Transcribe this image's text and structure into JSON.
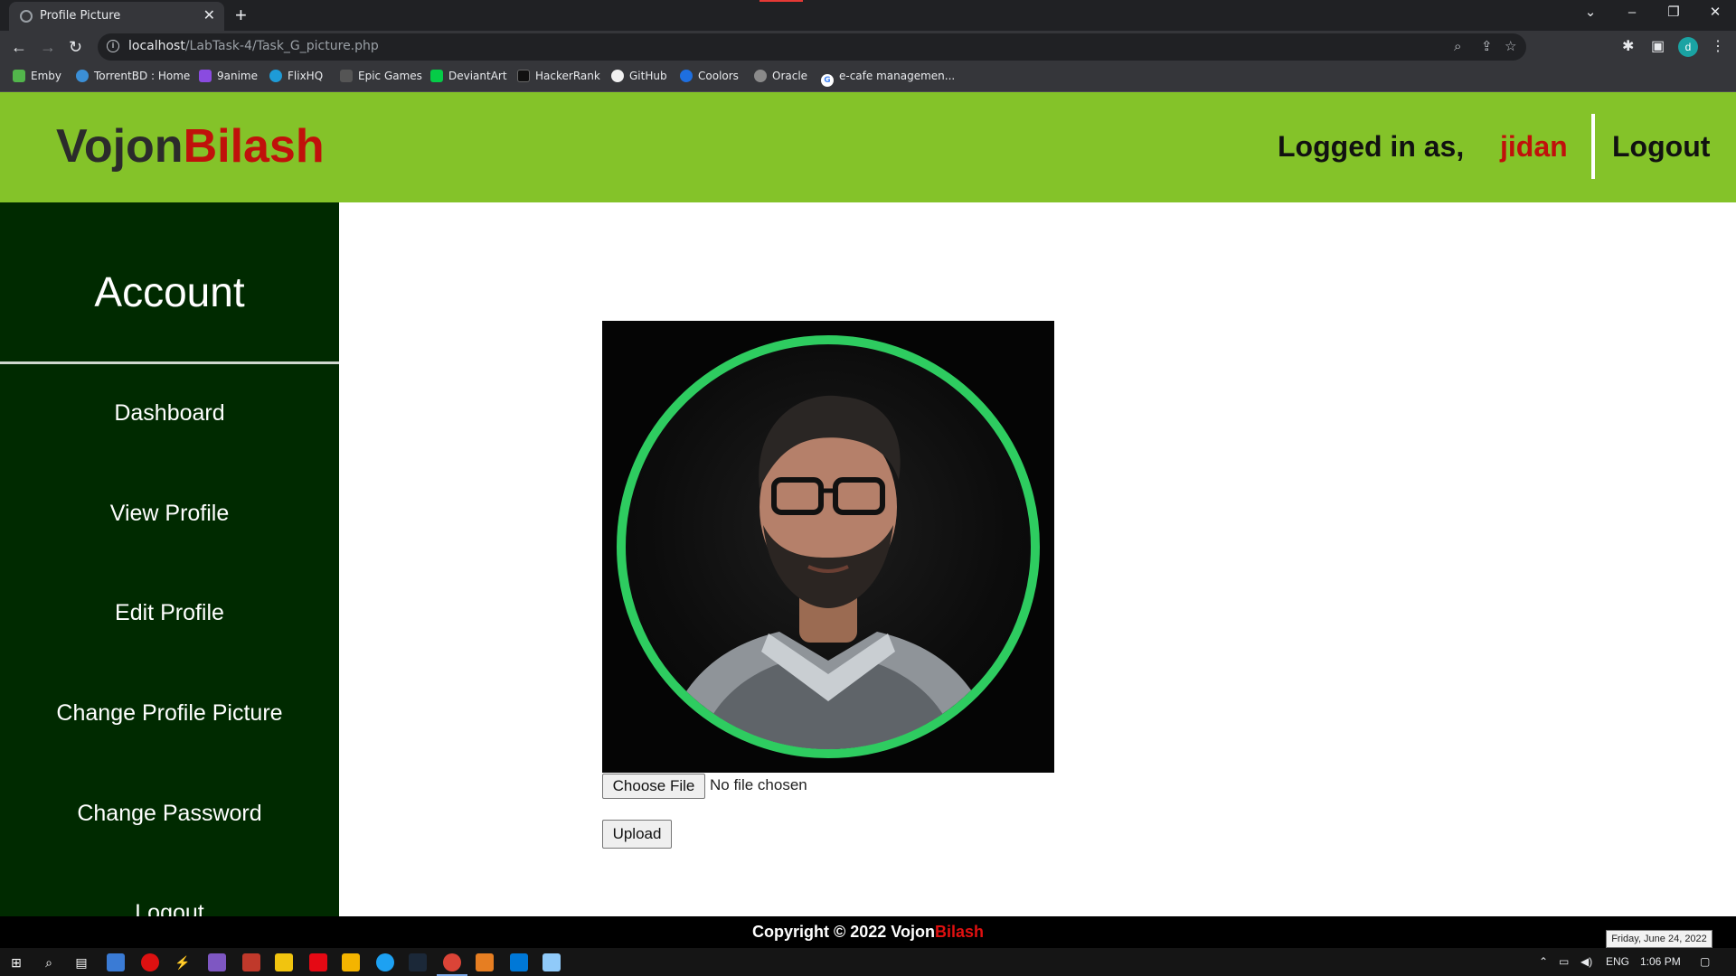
{
  "browser": {
    "tab_title": "Profile Picture",
    "url_host": "localhost",
    "url_path": "/LabTask-4/Task_G_picture.php",
    "profile_initial": "d",
    "bookmarks": [
      {
        "label": "Emby",
        "color": "#52b54b"
      },
      {
        "label": "TorrentBD : Home",
        "color": "#3b8fd6"
      },
      {
        "label": "9anime",
        "color": "#8a4be0"
      },
      {
        "label": "FlixHQ",
        "color": "#1e9bd7"
      },
      {
        "label": "Epic Games",
        "color": "#555555"
      },
      {
        "label": "DeviantArt",
        "color": "#05cc47"
      },
      {
        "label": "HackerRank",
        "color": "#111111"
      },
      {
        "label": "GitHub",
        "color": "#f0f0f0"
      },
      {
        "label": "Coolors",
        "color": "#1e6fe0"
      },
      {
        "label": "Oracle",
        "color": "#8a8a8a"
      },
      {
        "label": "e-cafe managemen...",
        "color": "#4285f4"
      }
    ]
  },
  "header": {
    "brand_part1": "Vojon",
    "brand_part2": "Bilash",
    "logged_in_label": "Logged in as,",
    "username": "jidan",
    "logout_label": "Logout"
  },
  "sidebar": {
    "title": "Account",
    "items": [
      {
        "label": "Dashboard"
      },
      {
        "label": "View Profile"
      },
      {
        "label": "Edit Profile"
      },
      {
        "label": "Change Profile Picture"
      },
      {
        "label": "Change Password"
      },
      {
        "label": "Logout"
      }
    ]
  },
  "upload_form": {
    "choose_file_label": "Choose File",
    "file_status": "No file chosen",
    "upload_label": "Upload"
  },
  "footer": {
    "copyright_prefix": "Copyright © 2022 Vojon",
    "copyright_brand_red": "Bilash"
  },
  "taskbar": {
    "language": "ENG",
    "time": "1:06 PM",
    "date_tooltip": "Friday, June 24, 2022"
  },
  "colors": {
    "header_bg": "#84c329",
    "sidebar_bg": "#002a00",
    "brand_red": "#c0110b",
    "ring_green": "#2ecc60"
  }
}
